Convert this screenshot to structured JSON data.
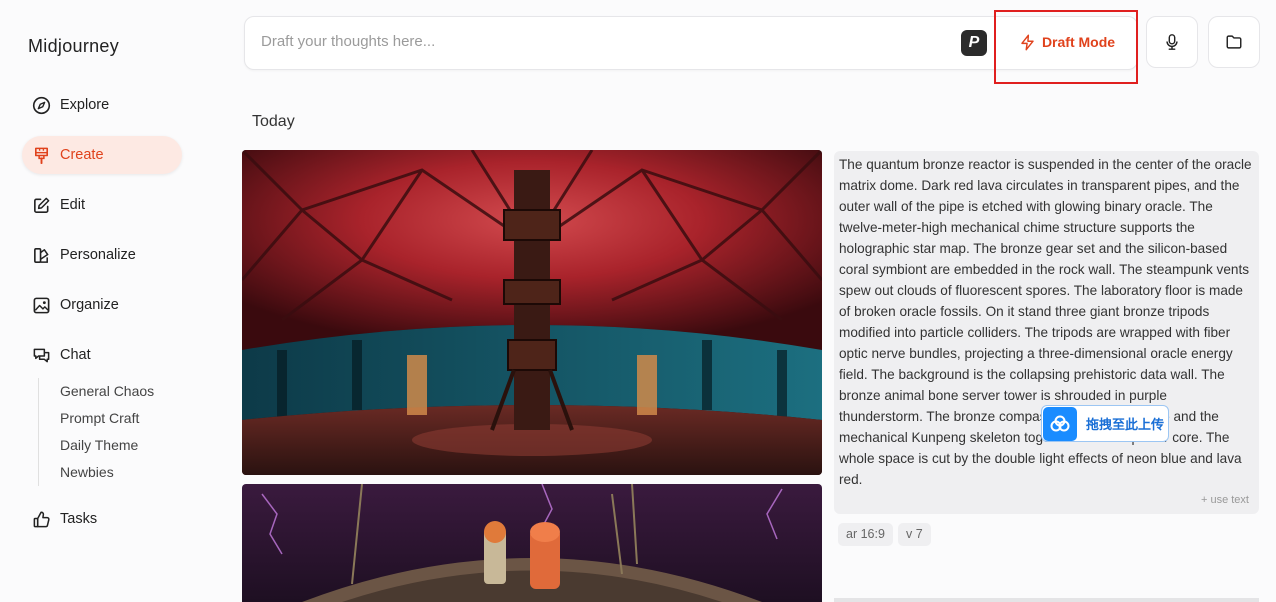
{
  "app": {
    "brand": "Midjourney"
  },
  "nav": [
    {
      "label": "Explore",
      "icon": "compass-icon"
    },
    {
      "label": "Create",
      "icon": "brush-icon",
      "active": true
    },
    {
      "label": "Edit",
      "icon": "edit-icon"
    },
    {
      "label": "Personalize",
      "icon": "personalize-icon"
    },
    {
      "label": "Organize",
      "icon": "image-icon"
    },
    {
      "label": "Chat",
      "icon": "chat-icon"
    }
  ],
  "chat_rooms": [
    "General Chaos",
    "Prompt Craft",
    "Daily Theme",
    "Newbies"
  ],
  "tasks": {
    "label": "Tasks",
    "icon": "thumbs-up-icon"
  },
  "prompt": {
    "placeholder": "Draft your thoughts here...",
    "badge": "P"
  },
  "toolbar": {
    "draft_label": "Draft Mode"
  },
  "feed": {
    "section": "Today",
    "prompt_text": "The quantum bronze reactor is suspended in the center of the oracle matrix dome. Dark red lava circulates in transparent pipes, and the outer wall of the pipe is etched with glowing binary oracle. The twelve-meter-high mechanical chime structure supports the holographic star map. The bronze gear set and the silicon-based coral symbiont are embedded in the rock wall. The steampunk vents spew out clouds of fluorescent spores. The laboratory floor is made of broken oracle fossils. On it stand three giant bronze tripods modified into particle colliders. The tripods are wrapped with fiber optic nerve bundles, projecting a three-dimensional oracle energy field. The background is the collapsing prehistoric data wall. The bronze animal bone server tower is shrouded in purple thunderstorm. The bronze compass hovering at the top and the mechanical Kunpeng skeleton together form the power core. The whole space is cut by the double light effects of neon blue and lava red.",
    "use_text": "+ use text",
    "tags": [
      "ar 16:9",
      "v 7"
    ]
  },
  "overlay": {
    "upload_label": "拖拽至此上传"
  },
  "colors": {
    "accent": "#e0421c",
    "highlight": "#e01f1f",
    "active_bg": "#fde9e3"
  }
}
